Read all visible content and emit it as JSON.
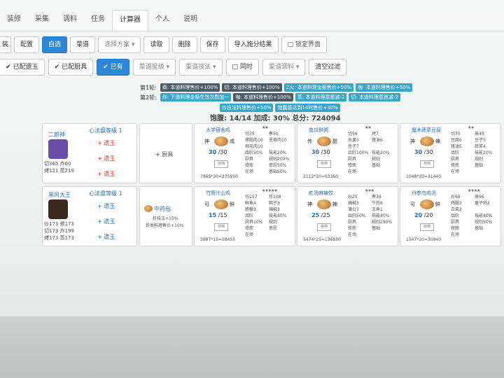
{
  "tabs": [
    "装修",
    "采集",
    "调料",
    "任务",
    "计算器",
    "个人",
    "说明"
  ],
  "active_tab": "计算器",
  "toolbar1": [
    "配置",
    "自选",
    "菜谱",
    "选择方案",
    "读取",
    "删除",
    "保存",
    "导入施分结果",
    "锁定界面"
  ],
  "toolbar2": [
    "已配遗玉",
    "已配厨具",
    "已有",
    "菜谱星级",
    "菜谱技法",
    "同时",
    "菜谱调料",
    "清空过滤"
  ],
  "left_cut": "装",
  "rounds": [
    {
      "label": "第1轮:",
      "chips": [
        {
          "text": "煮: 本道料理售价+100%",
          "style": "dark"
        },
        {
          "text": "切: 本道料理售价+100%",
          "style": "dark"
        },
        {
          "text": "2火: 本道料理金额售价+50%",
          "style": "teal"
        },
        {
          "text": "咖: 本道料理售价+50%",
          "style": "teal"
        }
      ]
    },
    {
      "label": "第2轮:",
      "chips": [
        {
          "text": "炸: 下道料理金额生效次数加一",
          "style": "teal"
        },
        {
          "text": "咖: 本道料理售价+100%",
          "style": "dark"
        },
        {
          "text": "蒸: 本道料理意愿减-2",
          "style": "teal"
        },
        {
          "text": "切: 本道料理意愿减-2",
          "style": "teal"
        }
      ]
    },
    {
      "label": "",
      "chips": [
        {
          "text": "炒技法料理售价+50%",
          "style": "teal"
        },
        {
          "text": "饱露感达到14时售价+30%",
          "style": "teal"
        }
      ]
    }
  ],
  "summary": "饱腹: 14/14 加成: 30% 总分: 724094",
  "chefs": [
    {
      "name": "二郎神",
      "stats": [
        "切365 炸60",
        "烤121 蒸219"
      ],
      "skill": "心法盘等级 1",
      "picks": [
        "+ 遗玉",
        "+ 遗玉",
        "+ 遗玉"
      ],
      "pick_color": "red",
      "avatar": "#6a4fa8"
    },
    {
      "name": "黑风大王",
      "stats": [
        "炒173 煮173",
        "切173 炸199",
        "烤173 蒸173"
      ],
      "skill": "心法盘等级 1",
      "picks": [
        "+ 遗玉",
        "+ 遗玉",
        "+ 遗玉"
      ],
      "pick_color": "blue",
      "avatar": "#3b2a20"
    }
  ],
  "equips": [
    {
      "label": "+ 厨具"
    },
    {
      "label": "中药包",
      "lines": [
        "炸技法+15%",
        "炸类料理售价+10%"
      ]
    }
  ],
  "dishes": [
    {
      "name": "大学宿舍鸡",
      "stars": "★★",
      "left": "切35\n猪腿肉10\n梅花肉10\n品阶50%\n厨具\n修炼\n在场",
      "right": "煮50\n里脊肉10\n\n技能20%\n规则200%\n意愿50%\n基础50%",
      "flav": [
        "神",
        "咸"
      ],
      "qty": "30",
      "max": "/30",
      "total": "7865*30=235950"
    },
    {
      "name": "南瓜鲜粥",
      "stars": "★★",
      "left": "切56\n水果5\n豆子7\n品阶100%\n厨具\n修炼\n在场",
      "right": "烤7\n猪油6\n\n技能20%\n规则\n基础\n",
      "flav": [
        "传",
        "甜"
      ],
      "qty": "30",
      "max": "/30",
      "total": "2112*30=63360"
    },
    {
      "name": "魔术蔬菜豆腐",
      "stars": "★★",
      "left": "切70\n豆腐6\n猪油5\n品阶\n厨具\n修炼\n在场",
      "right": "蒸45\n豆子5\n蔬菜4\n技能20%\n规则\n基础\n",
      "flav": [
        "神",
        "辣"
      ],
      "qty": "30",
      "max": "/30",
      "total": "1048*30=31440"
    },
    {
      "name": "竹筒汁山鸡",
      "stars": "★★★★★",
      "left": "切157\n鲜鱼4\n螃蟹3\n品阶\n厨具10%\n修炼\n在场",
      "right": "炸108\n鸭子3\n辣椒3\n技能40%\n规则\n意愿\n",
      "flav": [
        "可",
        "鲜"
      ],
      "qty": "15",
      "max": "/15",
      "total": "3897*15=58455"
    },
    {
      "name": "红汤麻辣饺",
      "stars": "★★★",
      "left": "炒25\n辣椒3\n蒲公7\n品阶50%\n厨具\n修炼\n在场",
      "right": "煮39\n牛肉6\n冻鱼1\n技能40%\n规则250%\n基础\n",
      "flav": [
        "神",
        "辣"
      ],
      "qty": "25",
      "max": "/25",
      "total": "5474*25=136850"
    },
    {
      "name": "丹参乌鸡汤",
      "stars": "★★★★",
      "left": "炒68\n鸡腿3\n白菜2\n品阶\n厨具\n修炼\n在场",
      "right": "蒸96\n童子鸡2\n\n技能40%\n规则50%\n基础\n",
      "flav": [
        "可",
        "鲜"
      ],
      "qty": "20",
      "max": "/20",
      "total": "1547*20=30940"
    }
  ],
  "dish_box_label": "存档"
}
